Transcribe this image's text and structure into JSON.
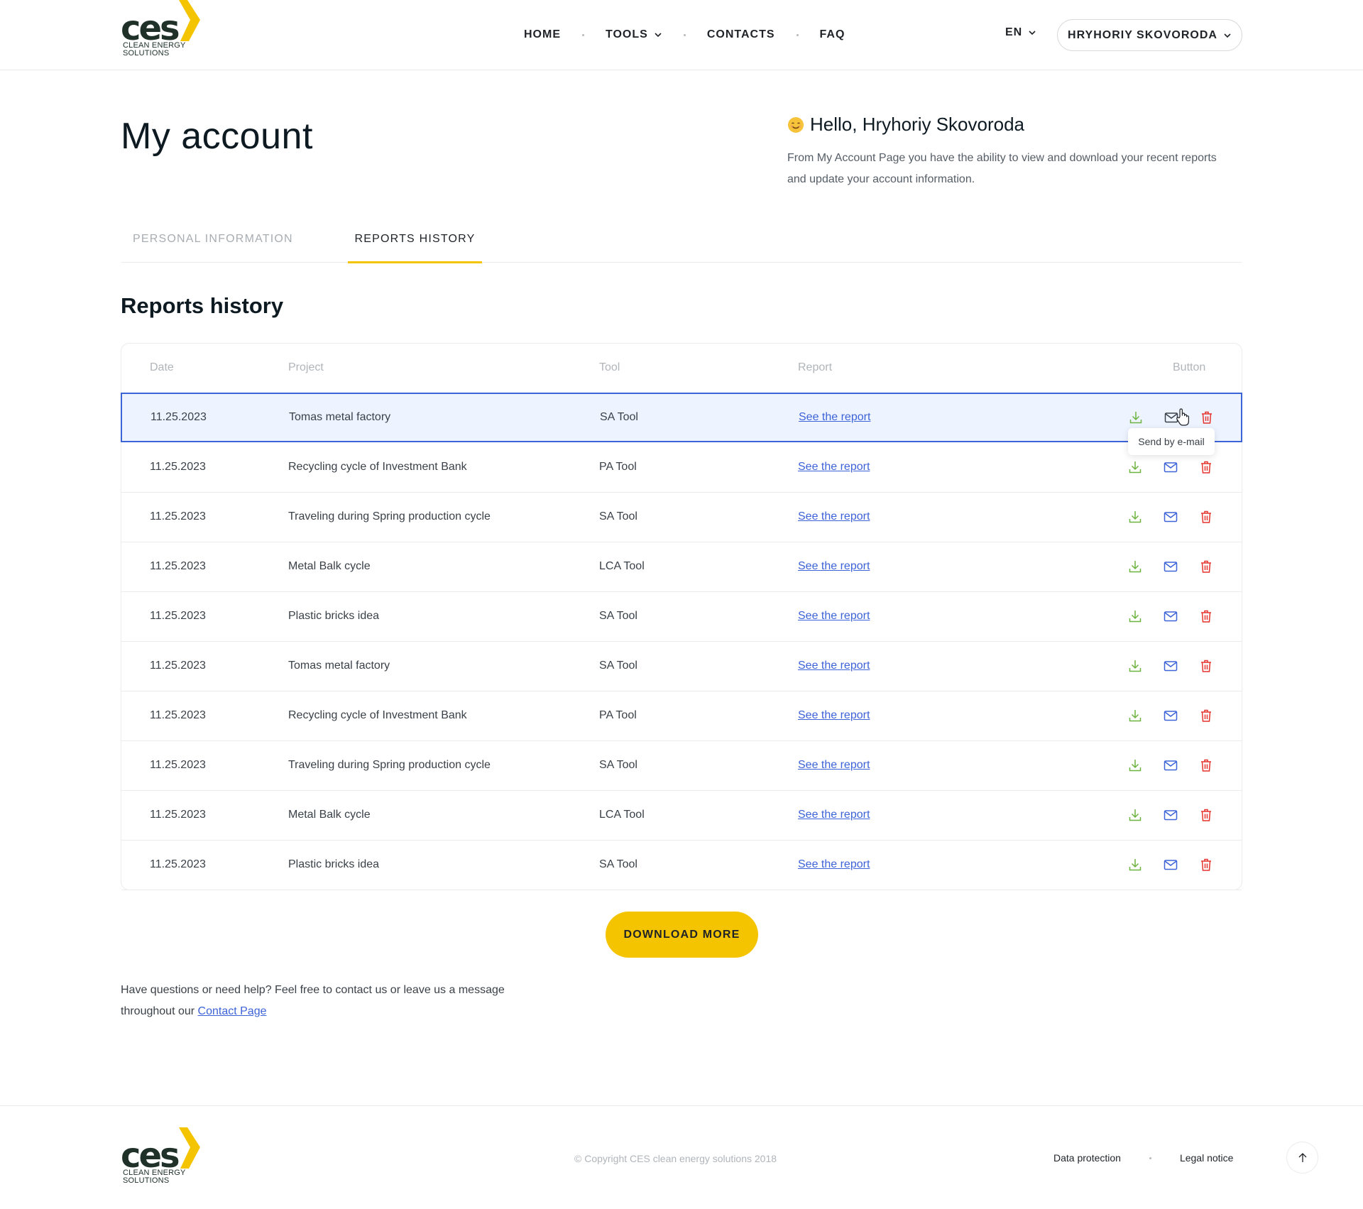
{
  "header": {
    "logo": {
      "mark": "ces",
      "tagline_1": "CLEAN ENERGY",
      "tagline_2": "SOLUTIONS"
    },
    "nav": [
      {
        "label": "HOME"
      },
      {
        "label": "TOOLS",
        "has_dropdown": true
      },
      {
        "label": "CONTACTS"
      },
      {
        "label": "FAQ"
      }
    ],
    "language": "EN",
    "user_name": "HRYHORIY SKOVORODA"
  },
  "intro": {
    "page_title": "My account",
    "greeting": "Hello, Hryhoriy Skovoroda",
    "description": "From My Account Page you have the ability to view and download your recent reports and update your account information."
  },
  "tabs": [
    {
      "label": "PERSONAL INFORMATION",
      "active": false
    },
    {
      "label": "REPORTS HISTORY",
      "active": true
    }
  ],
  "reports": {
    "title": "Reports history",
    "columns": [
      "Date",
      "Project",
      "Tool",
      "Report",
      "Button"
    ],
    "rows": [
      {
        "date": "11.25.2023",
        "project": "Tomas metal factory",
        "tool": "SA Tool",
        "report": "See the report"
      },
      {
        "date": "11.25.2023",
        "project": "Recycling cycle of Investment Bank",
        "tool": "PA Tool",
        "report": "See the report"
      },
      {
        "date": "11.25.2023",
        "project": "Traveling during Spring production cycle",
        "tool": "SA Tool",
        "report": "See the report"
      },
      {
        "date": "11.25.2023",
        "project": "Metal Balk cycle",
        "tool": "LCA Tool",
        "report": "See the report"
      },
      {
        "date": "11.25.2023",
        "project": "Plastic bricks idea",
        "tool": "SA Tool",
        "report": "See the report"
      },
      {
        "date": "11.25.2023",
        "project": "Tomas metal factory",
        "tool": "SA Tool",
        "report": "See the report"
      },
      {
        "date": "11.25.2023",
        "project": "Recycling cycle of Investment Bank",
        "tool": "PA Tool",
        "report": "See the report"
      },
      {
        "date": "11.25.2023",
        "project": "Traveling during Spring production cycle",
        "tool": "SA Tool",
        "report": "See the report"
      },
      {
        "date": "11.25.2023",
        "project": "Metal Balk cycle",
        "tool": "LCA Tool",
        "report": "See the report"
      },
      {
        "date": "11.25.2023",
        "project": "Plastic bricks idea",
        "tool": "SA Tool",
        "report": "See the report"
      }
    ],
    "tooltip": "Send by e-mail",
    "icons": {
      "download": "download-icon",
      "email": "mail-icon",
      "delete": "trash-icon"
    }
  },
  "download_more_label": "DOWNLOAD MORE",
  "help": {
    "text": "Have questions or need help? Feel free to contact us or leave us a message throughout our",
    "link": "Contact Page"
  },
  "footer": {
    "copyright": "© Copyright CES clean energy solutions 2018",
    "links": [
      "Data protection",
      "Legal notice"
    ]
  },
  "colors": {
    "accent": "#f5c400",
    "link": "#3d63d8",
    "download": "#6cb33f",
    "delete": "#e5342d",
    "row_highlight": "#eef4ff"
  }
}
